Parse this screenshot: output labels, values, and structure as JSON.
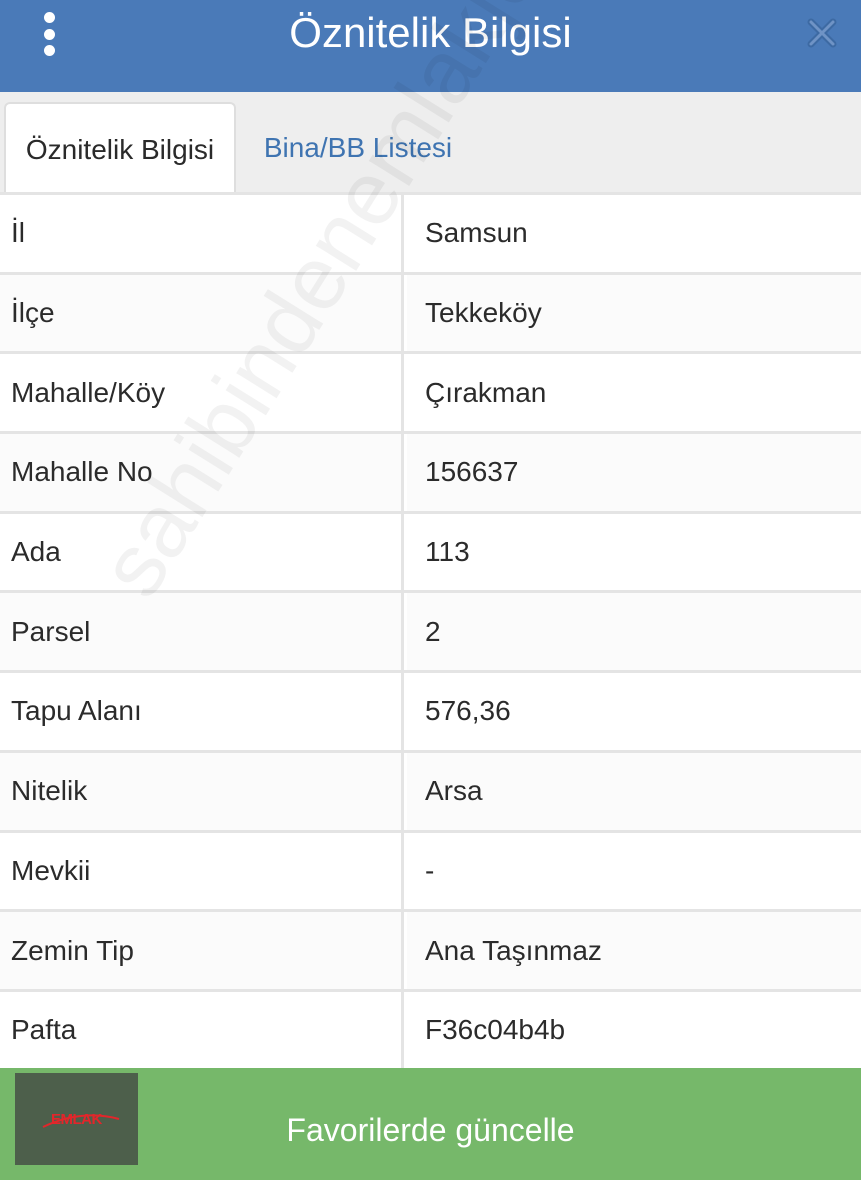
{
  "header": {
    "title": "Öznitelik Bilgisi",
    "menu_icon": "vertical-dots-icon",
    "close_icon": "close-x-icon",
    "bg_color": "#4a7ab8"
  },
  "tabs": [
    {
      "label": "Öznitelik Bilgisi",
      "active": true
    },
    {
      "label": "Bina/BB Listesi",
      "active": false
    }
  ],
  "rows": [
    {
      "key": "İl",
      "value": "Samsun"
    },
    {
      "key": "İlçe",
      "value": "Tekkeköy"
    },
    {
      "key": "Mahalle/Köy",
      "value": "Çırakman"
    },
    {
      "key": "Mahalle No",
      "value": "156637"
    },
    {
      "key": "Ada",
      "value": "113"
    },
    {
      "key": "Parsel",
      "value": "2"
    },
    {
      "key": "Tapu Alanı",
      "value": "576,36"
    },
    {
      "key": "Nitelik",
      "value": "Arsa"
    },
    {
      "key": "Mevkii",
      "value": "-"
    },
    {
      "key": "Zemin Tip",
      "value": "Ana Taşınmaz"
    },
    {
      "key": "Pafta",
      "value": "F36c04b4b"
    }
  ],
  "watermark": "sahibindenemlakjet.com",
  "footer": {
    "label": "Favorilerde güncelle",
    "logo_text": "EMLAK",
    "bg_color": "#76b86a"
  }
}
